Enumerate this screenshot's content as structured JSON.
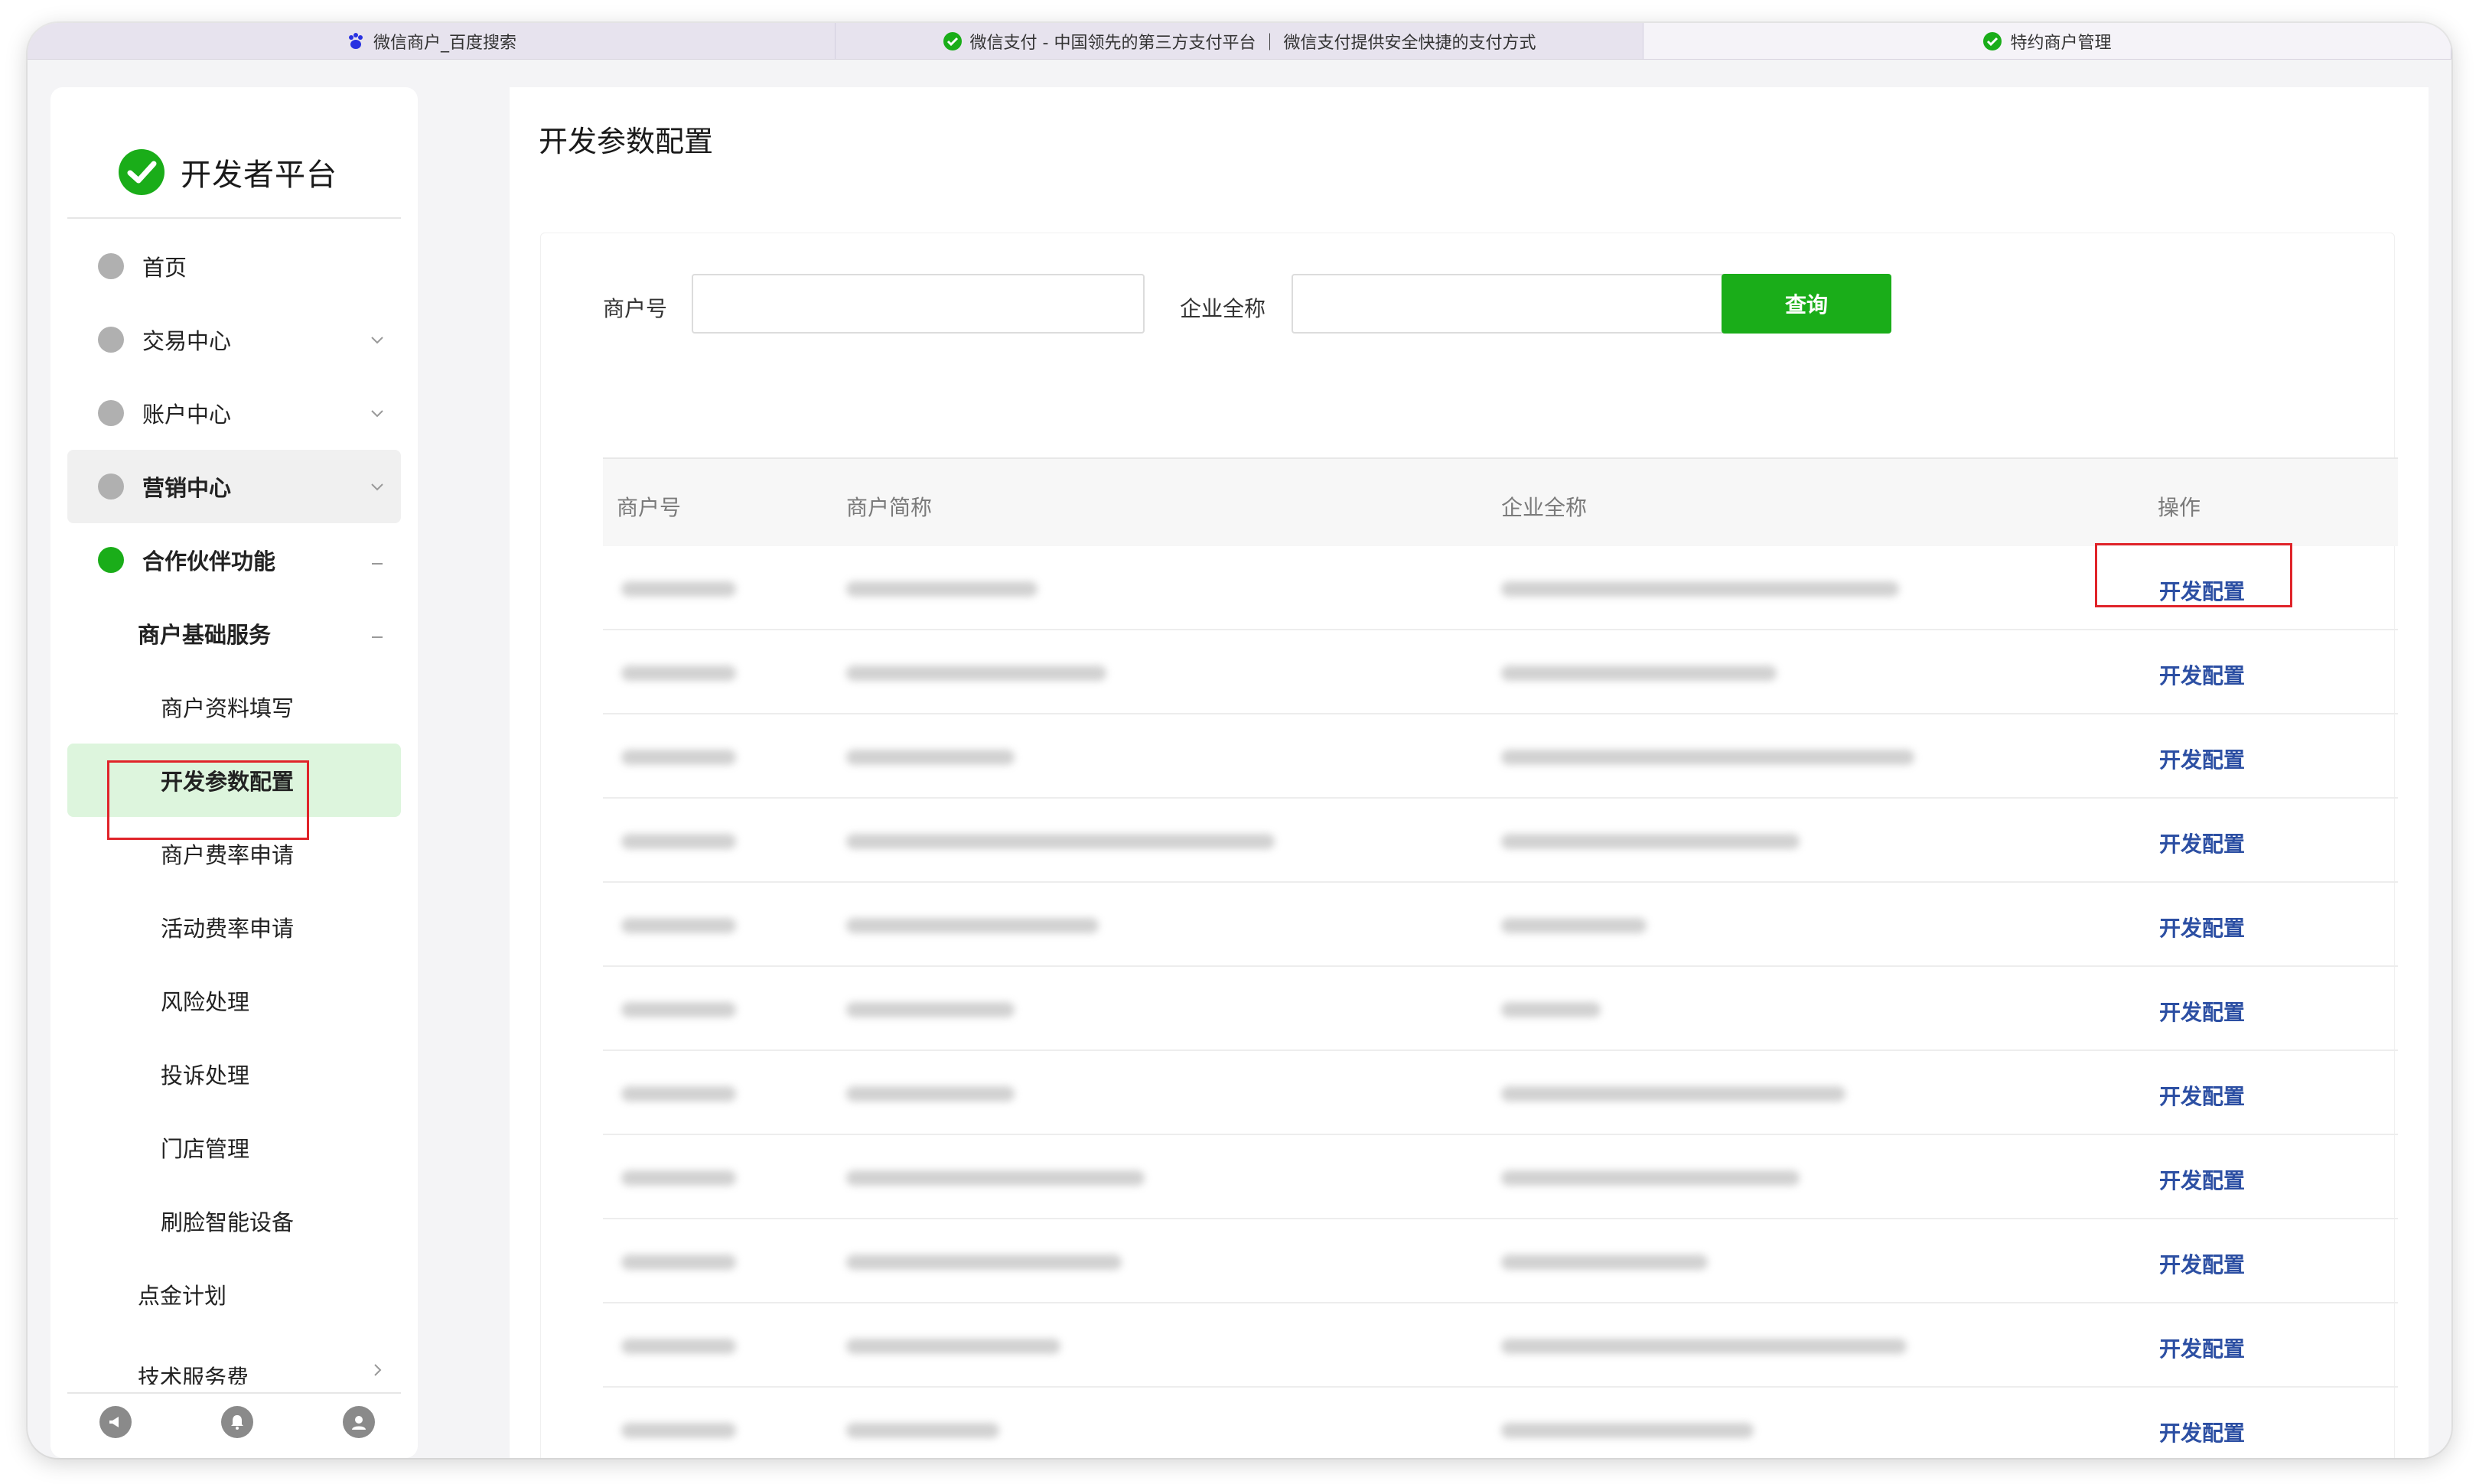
{
  "tabs": [
    {
      "label": "微信商户_百度搜索",
      "icon": "baidu-paw-icon"
    },
    {
      "label": "微信支付 - 中国领先的第三方支付平台 ｜ 微信支付提供安全快捷的支付方式",
      "icon": "wechat-icon"
    },
    {
      "label": "特约商户管理",
      "icon": "wechat-icon"
    }
  ],
  "sidebar": {
    "logo_text": "开发者平台",
    "items": [
      {
        "label": "首页"
      },
      {
        "label": "交易中心"
      },
      {
        "label": "账户中心"
      },
      {
        "label": "营销中心"
      },
      {
        "label": "合作伙伴功能"
      },
      {
        "label": "商户基础服务"
      },
      {
        "label": "商户资料填写"
      },
      {
        "label": "开发参数配置"
      },
      {
        "label": "商户费率申请"
      },
      {
        "label": "活动费率申请"
      },
      {
        "label": "风险处理"
      },
      {
        "label": "投诉处理"
      },
      {
        "label": "门店管理"
      },
      {
        "label": "刷脸智能设备"
      },
      {
        "label": "点金计划"
      },
      {
        "label": "技术服务费"
      }
    ],
    "bottom_icons": [
      "megaphone-icon",
      "bell-icon",
      "user-icon"
    ]
  },
  "main": {
    "title": "开发参数配置",
    "search": {
      "merchant_no_label": "商户号",
      "merchant_no_value": "",
      "company_label": "企业全称",
      "company_value": "",
      "query_button": "查询"
    },
    "table": {
      "headers": [
        "商户号",
        "商户简称",
        "企业全称",
        "操作"
      ],
      "rows": [
        {
          "action": "开发配置"
        },
        {
          "action": "开发配置"
        },
        {
          "action": "开发配置"
        },
        {
          "action": "开发配置"
        },
        {
          "action": "开发配置"
        },
        {
          "action": "开发配置"
        },
        {
          "action": "开发配置"
        },
        {
          "action": "开发配置"
        },
        {
          "action": "开发配置"
        },
        {
          "action": "开发配置"
        },
        {
          "action": "开发配置"
        }
      ]
    }
  },
  "colors": {
    "brand_green": "#1aad19",
    "link_blue": "#2c4fa3",
    "highlight_red": "#e0242a",
    "active_bg": "#ddf5dd"
  }
}
